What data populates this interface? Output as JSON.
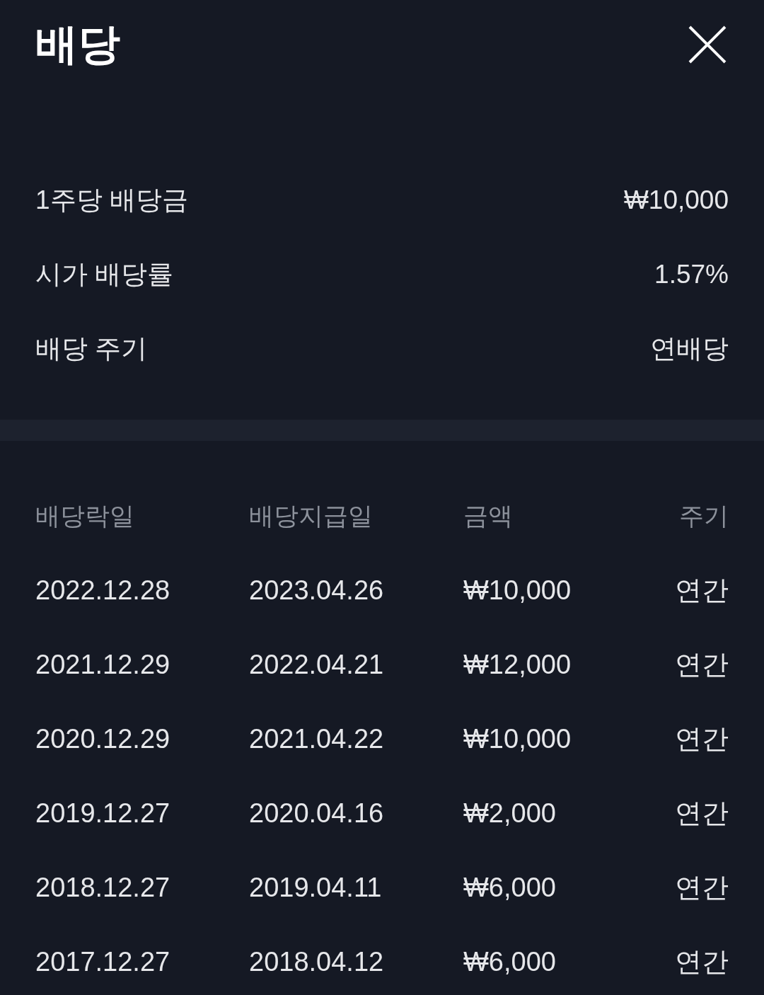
{
  "title": "배당",
  "summary": [
    {
      "label": "1주당 배당금",
      "value": "₩10,000"
    },
    {
      "label": "시가 배당률",
      "value": "1.57%"
    },
    {
      "label": "배당 주기",
      "value": "연배당"
    }
  ],
  "table": {
    "columns": [
      "배당락일",
      "배당지급일",
      "금액",
      "주기"
    ],
    "rows": [
      [
        "2022.12.28",
        "2023.04.26",
        "₩10,000",
        "연간"
      ],
      [
        "2021.12.29",
        "2022.04.21",
        "₩12,000",
        "연간"
      ],
      [
        "2020.12.29",
        "2021.04.22",
        "₩10,000",
        "연간"
      ],
      [
        "2019.12.27",
        "2020.04.16",
        "₩2,000",
        "연간"
      ],
      [
        "2018.12.27",
        "2019.04.11",
        "₩6,000",
        "연간"
      ],
      [
        "2017.12.27",
        "2018.04.12",
        "₩6,000",
        "연간"
      ]
    ]
  }
}
